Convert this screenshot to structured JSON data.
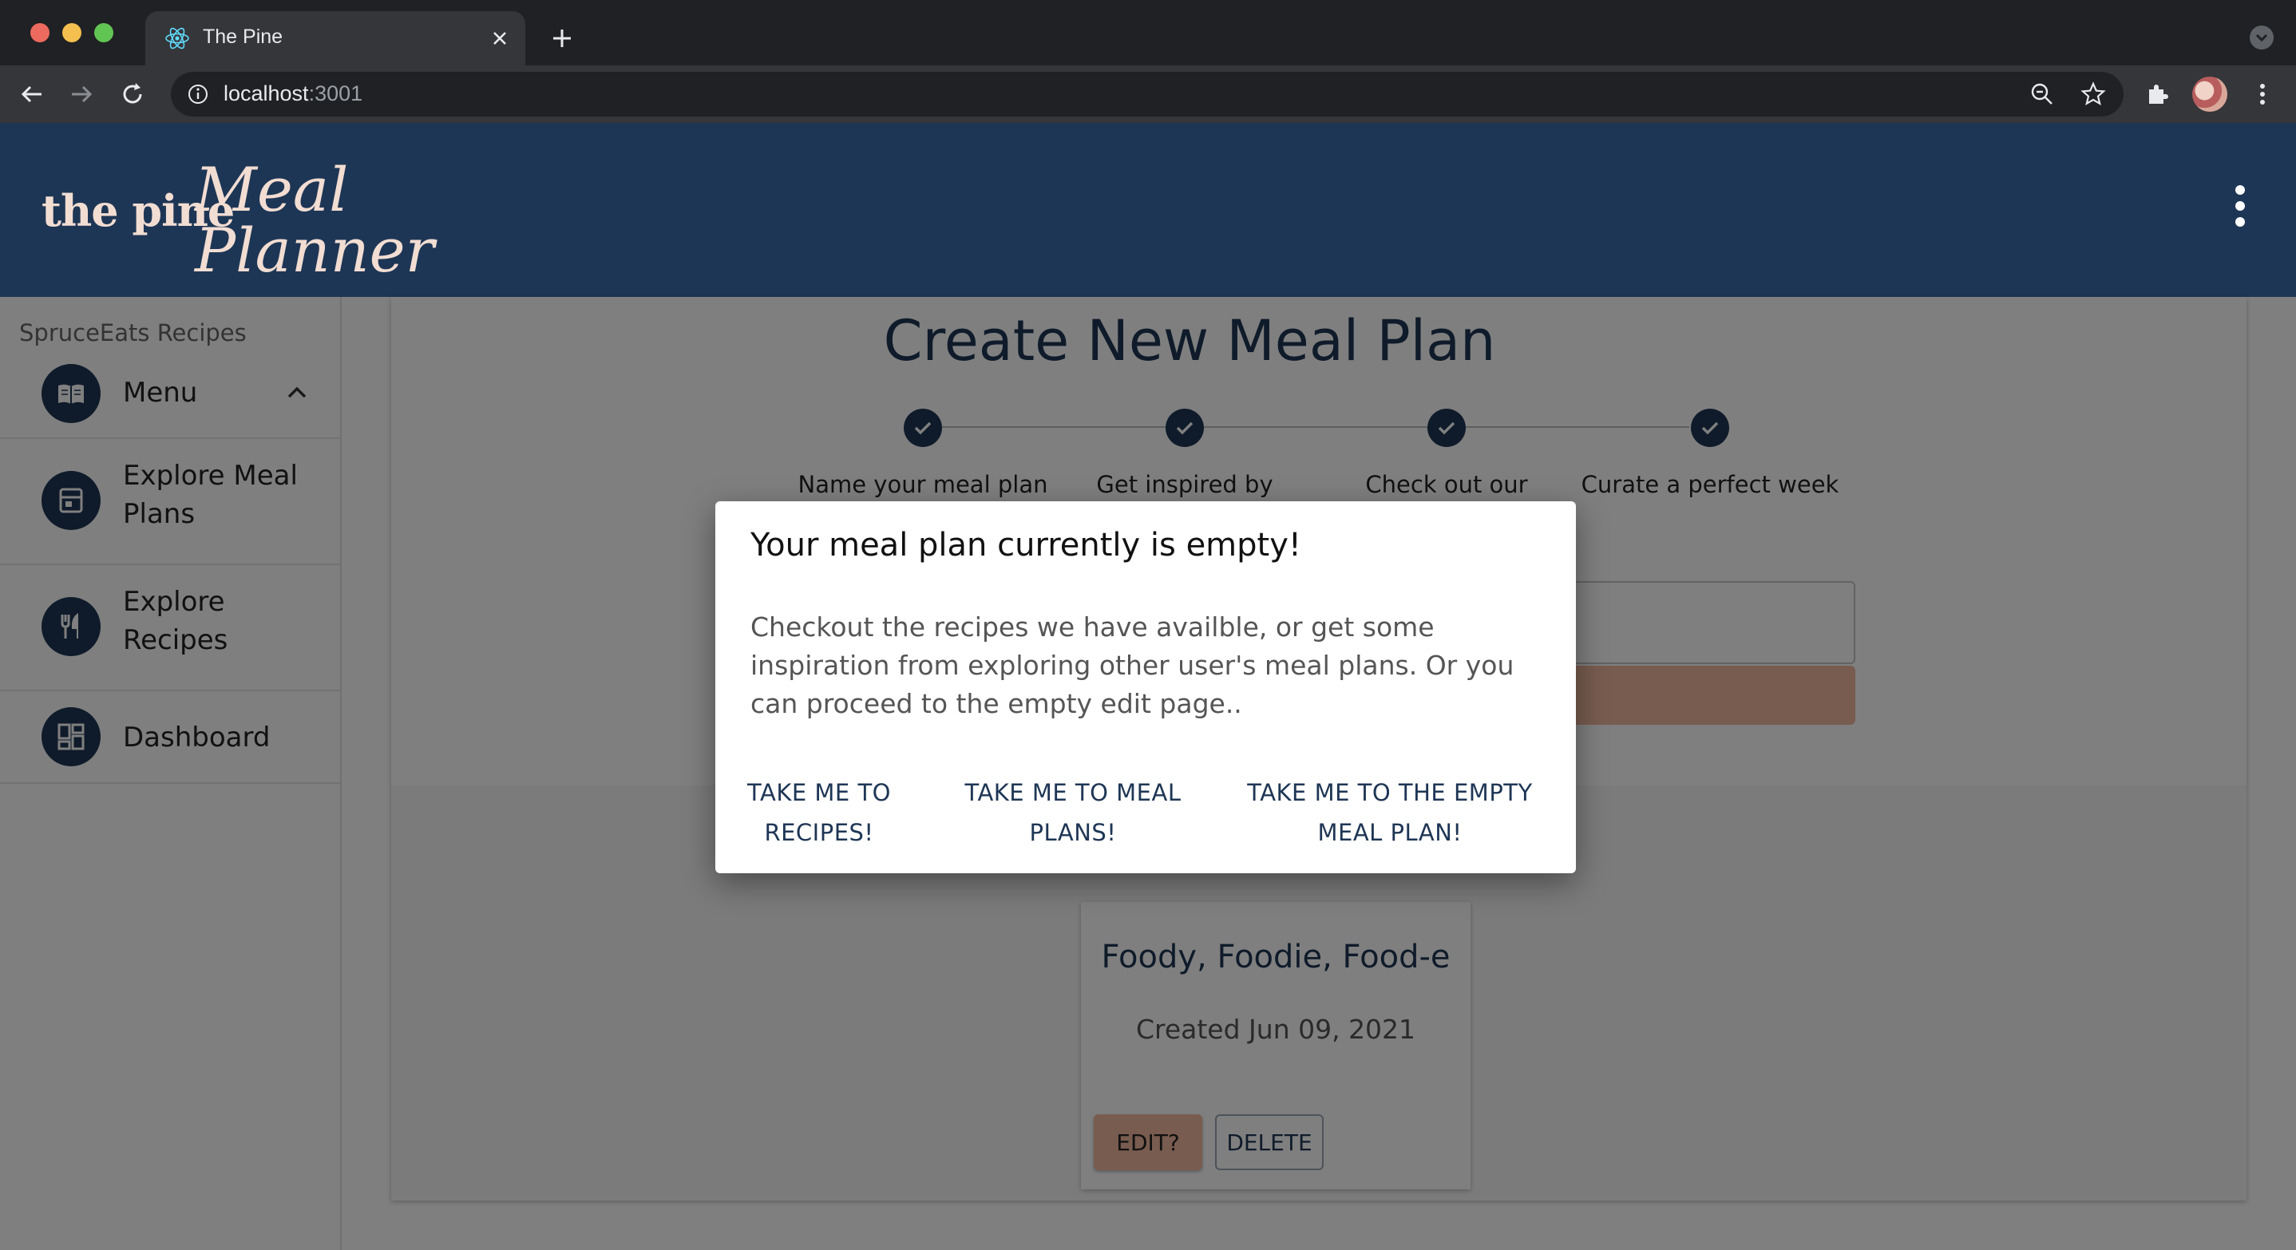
{
  "browser": {
    "tab_title": "The Pine",
    "url_host": "localhost",
    "url_port": ":3001"
  },
  "header": {
    "logo_prefix": "the pine",
    "logo_line1": "Meal",
    "logo_line2": "Planner"
  },
  "sidebar": {
    "section_title": "SpruceEats Recipes",
    "items": [
      {
        "label": "Menu",
        "icon": "book-icon"
      },
      {
        "label": "Explore Meal Plans",
        "icon": "calendar-icon"
      },
      {
        "label": "Explore Recipes",
        "icon": "utensils-icon"
      },
      {
        "label": "Dashboard",
        "icon": "dashboard-icon"
      }
    ]
  },
  "main": {
    "title": "Create New Meal Plan",
    "steps": [
      {
        "label": "Name your meal plan"
      },
      {
        "label": "Get inspired by"
      },
      {
        "label": "Check out our"
      },
      {
        "label": "Curate a perfect week"
      }
    ],
    "plan_card": {
      "name": "Foody, Foodie, Food-e",
      "created": "Created Jun 09, 2021",
      "edit_label": "EDIT?",
      "delete_label": "DELETE"
    }
  },
  "dialog": {
    "title": "Your meal plan currently is empty!",
    "body": "Checkout the recipes we have availble, or get some inspiration from exploring other user's meal plans. Or you can proceed to the empty edit page..",
    "actions": [
      {
        "line1": "TAKE ME TO",
        "line2": "RECIPES!"
      },
      {
        "line1": "TAKE ME TO MEAL",
        "line2": "PLANS!"
      },
      {
        "line1": "TAKE ME TO THE EMPTY",
        "line2": "MEAL PLAN!"
      }
    ]
  },
  "colors": {
    "primary": "#1e3655",
    "accent": "#f0b89f",
    "chrome_dark": "#202124"
  }
}
